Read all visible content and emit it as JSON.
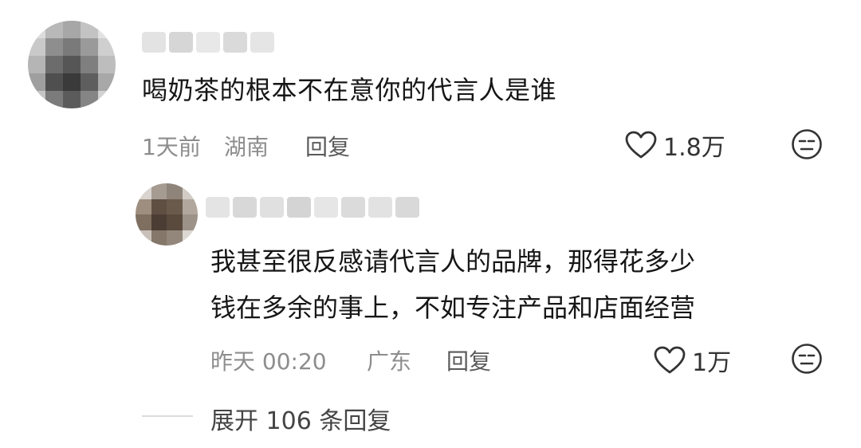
{
  "comment": {
    "text": "喝奶茶的根本不在意你的代言人是谁",
    "time": "1天前",
    "location": "湖南",
    "reply_label": "回复",
    "like_count": "1.8万",
    "icons": {
      "like": "heart-outline-icon",
      "dislike": "neutral-face-icon"
    }
  },
  "reply": {
    "text_line1": "我甚至很反感请代言人的品牌，那得花多少",
    "text_line2": "钱在多余的事上，不如专注产品和店面经营",
    "time": "昨天 00:20",
    "location": "广东",
    "reply_label": "回复",
    "like_count": "1万",
    "icons": {
      "like": "heart-outline-icon",
      "dislike": "neutral-face-icon"
    }
  },
  "expand": {
    "label": "展开 106 条回复"
  },
  "colors": {
    "text": "#161616",
    "meta": "#8d8d8d",
    "icon": "#333333"
  }
}
